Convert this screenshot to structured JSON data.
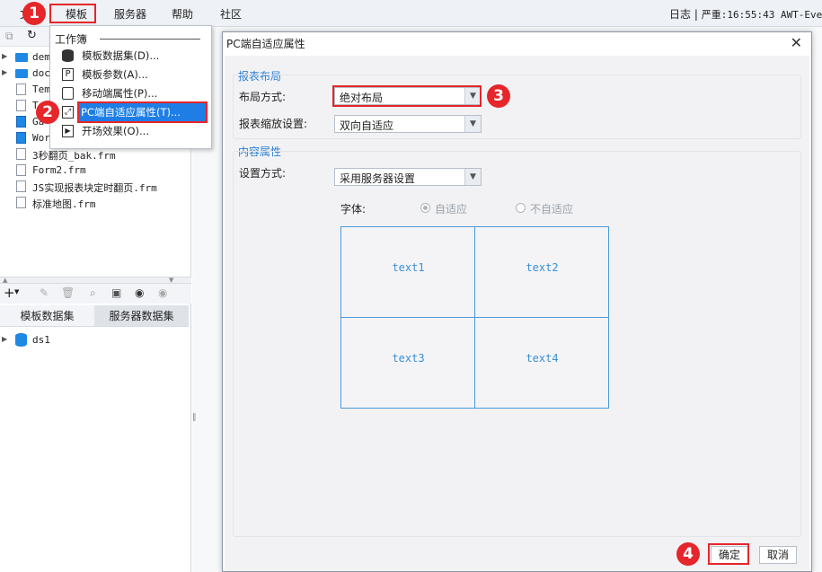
{
  "menubar": {
    "items": [
      "模板",
      "服务器",
      "帮助",
      "社区"
    ],
    "status_log": "日志",
    "status_sep": "|",
    "status_text": "严重:16:55:43 AWT-Eve"
  },
  "file_tree": {
    "items": [
      {
        "label": "dem",
        "icon": "folder-icon"
      },
      {
        "label": "doc",
        "icon": "folder-icon"
      },
      {
        "label": "Tem",
        "icon": "file-icon"
      },
      {
        "label": "T",
        "icon": "file-icon"
      },
      {
        "label": "Ga",
        "icon": "form-file-icon"
      },
      {
        "label": "Wor",
        "icon": "form-file-icon"
      },
      {
        "label": "3秒翻页_bak.frm",
        "icon": "file-icon"
      },
      {
        "label": "Form2.frm",
        "icon": "file-icon"
      },
      {
        "label": "JS实现报表块定时翻页.frm",
        "icon": "file-icon"
      },
      {
        "label": "标准地图.frm",
        "icon": "file-icon"
      }
    ]
  },
  "dataset_panel": {
    "tabs": [
      "模板数据集",
      "服务器数据集"
    ],
    "items": [
      {
        "label": "ds1",
        "icon": "database-icon"
      }
    ]
  },
  "dropdown": {
    "header": "工作簿",
    "items": [
      {
        "label": "模板数据集(D)...",
        "icon": "database-icon"
      },
      {
        "label": "模板参数(A)...",
        "icon": "parameter-icon"
      },
      {
        "label": "移动端属性(P)...",
        "icon": "mobile-icon"
      },
      {
        "label": "PC端自适应属性(T)...",
        "icon": "resize-icon"
      },
      {
        "label": "开场效果(O)...",
        "icon": "film-icon"
      }
    ]
  },
  "dialog": {
    "title": "PC端自适应属性",
    "report_layout": {
      "title": "报表布局",
      "layout_label": "布局方式:",
      "layout_value": "绝对布局",
      "scale_label": "报表缩放设置:",
      "scale_value": "双向自适应"
    },
    "content_props": {
      "title": "内容属性",
      "setting_label": "设置方式:",
      "setting_value": "采用服务器设置",
      "font_label": "字体:",
      "radio_options": [
        "自适应",
        "不自适应"
      ],
      "radio_selected": 0
    },
    "preview_cells": [
      "text1",
      "text2",
      "text3",
      "text4"
    ],
    "ok_label": "确定",
    "cancel_label": "取消"
  },
  "annotations": [
    "1",
    "2",
    "3",
    "4"
  ],
  "colors": {
    "annotation_red": "#e5262a",
    "selection_blue": "#1e7ee6",
    "group_title_blue": "#2a7fd4",
    "preview_border": "#4a9ad8"
  }
}
